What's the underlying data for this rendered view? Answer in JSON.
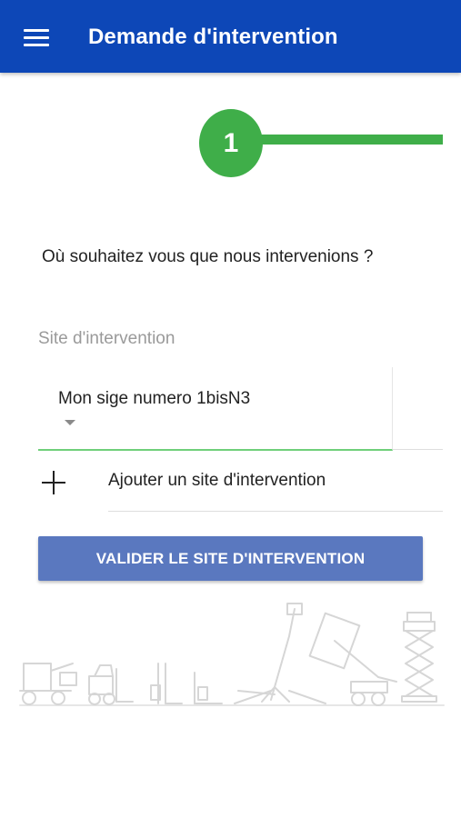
{
  "header": {
    "title": "Demande d'intervention",
    "menu_icon": "hamburger-menu-icon",
    "background_color": "#0d47b7"
  },
  "stepper": {
    "current_step": "1",
    "active_color": "#3fae49"
  },
  "main": {
    "question": "Où souhaitez vous que nous intervenions ?",
    "site_field": {
      "label": "Site d'intervention",
      "selected_value": "Mon sige numero 1bisN3",
      "underline_color": "#6fcf7a"
    },
    "add_site": {
      "icon": "plus-icon",
      "label": "Ajouter un site d'intervention"
    },
    "validate_button": {
      "label": "VALIDER LE SITE D'INTERVENTION",
      "color": "#5a78bf"
    }
  },
  "illustration": {
    "description_icon": "machinery-illustration",
    "color": "#d6d6d6"
  }
}
